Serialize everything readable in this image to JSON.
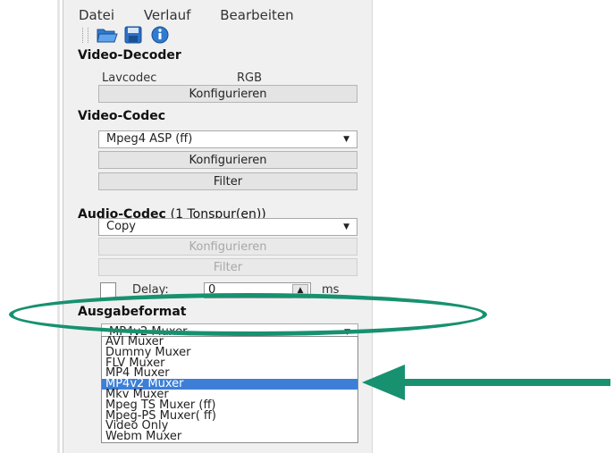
{
  "menu": [
    "Datei",
    "Verlauf",
    "Bearbeiten"
  ],
  "toolbar": {
    "icons": [
      "open-folder-icon",
      "save-disk-icon",
      "info-icon"
    ]
  },
  "video_decoder": {
    "title": "Video-Decoder",
    "decoder": "Lavcodec",
    "format": "RGB",
    "configure_label": "Konfigurieren"
  },
  "video_codec": {
    "title": "Video-Codec",
    "selected": "Mpeg4 ASP (ff)",
    "configure_label": "Konfigurieren",
    "filter_label": "Filter"
  },
  "audio_codec": {
    "title": "Audio-Codec",
    "subtitle": "(1 Tonspur(en))",
    "selected": "Copy",
    "configure_label": "Konfigurieren",
    "filter_label": "Filter",
    "delay_label": "Delay:",
    "delay_value": "0",
    "delay_unit": "ms"
  },
  "output_format": {
    "title": "Ausgabeformat",
    "selected": "MP4v2 Muxer",
    "options": [
      "AVI Muxer",
      "Dummy Muxer",
      "FLV Muxer",
      "MP4 Muxer",
      "MP4v2 Muxer",
      "Mkv Muxer",
      "Mpeg TS Muxer (ff)",
      "Mpeg-PS Muxer( ff)",
      "Video Only",
      "Webm Muxer"
    ],
    "highlighted_index": 4
  },
  "colors": {
    "annotation": "#17916f",
    "selection": "#3d7fd6"
  }
}
